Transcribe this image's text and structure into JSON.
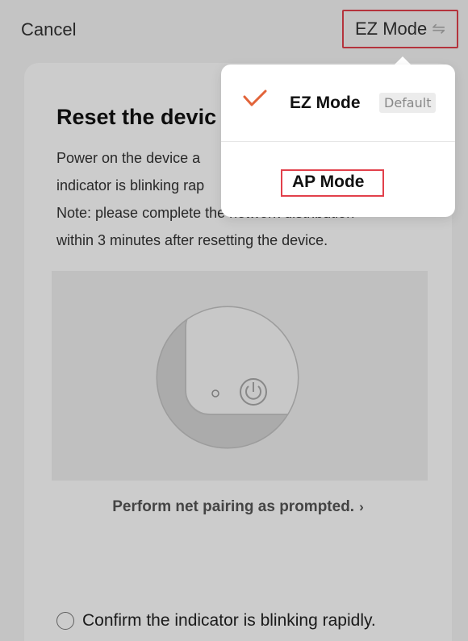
{
  "topbar": {
    "cancel_label": "Cancel",
    "mode_label": "EZ Mode",
    "mode_icon": "swap-arrows-icon"
  },
  "card": {
    "title": "Reset the devic",
    "description_lines": [
      "Power on the device a",
      "indicator is blinking rap",
      "Note: please complete the network distribution",
      "within 3 minutes after resetting the device."
    ],
    "prompt_link": "Perform net pairing as prompted.",
    "prompt_arrow": "›",
    "confirm_label": "Confirm the indicator is blinking rapidly."
  },
  "dropdown": {
    "options": [
      {
        "label": "EZ Mode",
        "badge": "Default",
        "selected": true
      },
      {
        "label": "AP Mode",
        "selected": false
      }
    ]
  },
  "colors": {
    "accent_check": "#e2643a",
    "highlight_border": "#e2404b"
  }
}
